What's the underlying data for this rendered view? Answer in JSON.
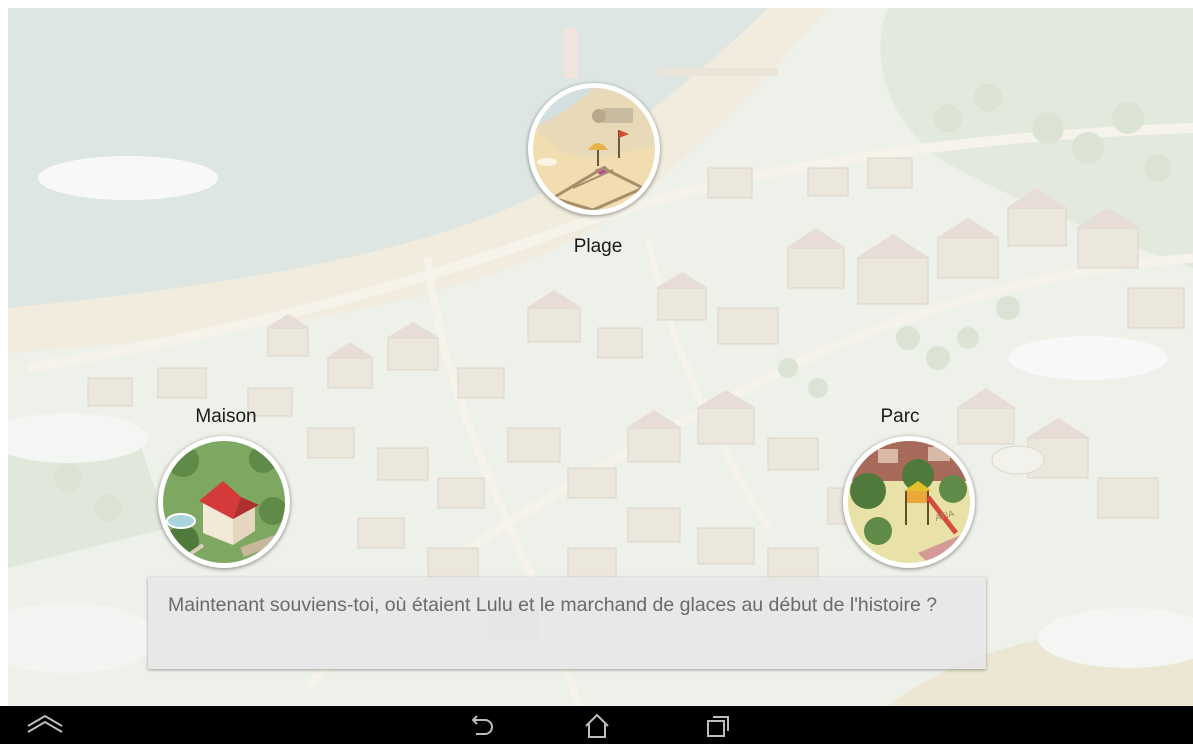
{
  "locations": [
    {
      "id": "plage",
      "label": "Plage",
      "icon": "beach-thumbnail"
    },
    {
      "id": "maison",
      "label": "Maison",
      "icon": "house-thumbnail"
    },
    {
      "id": "parc",
      "label": "Parc",
      "icon": "park-thumbnail"
    }
  ],
  "question": {
    "text": "Maintenant souviens-toi, où étaient Lulu et le marchand de glaces au début de l'histoire ?"
  },
  "navbar": {
    "icons": [
      "hide-bar-icon",
      "back-icon",
      "home-icon",
      "recent-apps-icon"
    ]
  },
  "colors": {
    "navbar": "#000000",
    "question_panel": "#e6e6e6",
    "question_text": "#6a6a6a",
    "label_text": "#1a1a1a"
  }
}
